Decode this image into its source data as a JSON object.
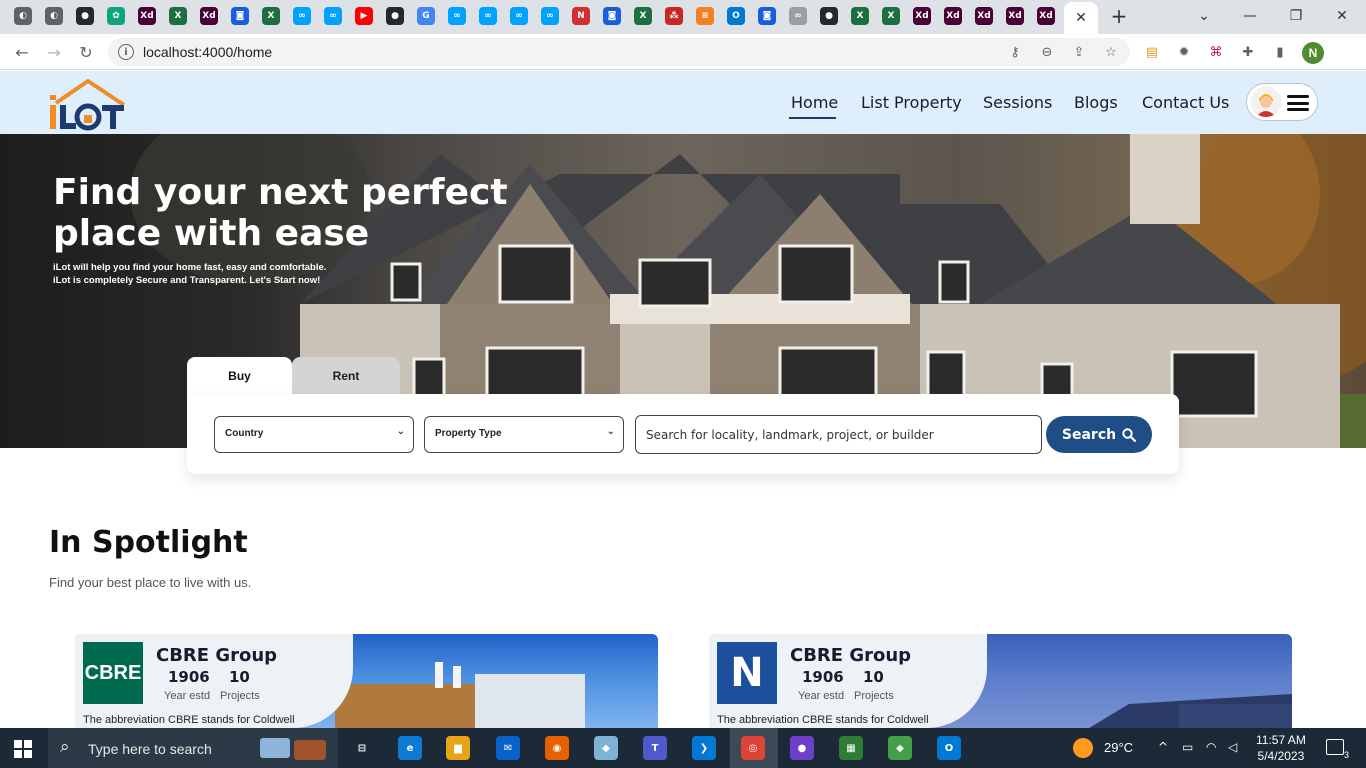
{
  "browser": {
    "tab_favicons": [
      {
        "icon": "chrome-icon",
        "glyph": "◐",
        "color": "#5f6368"
      },
      {
        "icon": "chrome-icon",
        "glyph": "◐",
        "color": "#5f6368"
      },
      {
        "icon": "github-icon",
        "glyph": "●",
        "color": "#24292f"
      },
      {
        "icon": "chatgpt-icon",
        "glyph": "✿",
        "color": "#10a37f"
      },
      {
        "icon": "adobe-xd-icon",
        "glyph": "Xd",
        "color": "#470137"
      },
      {
        "icon": "excel-icon",
        "glyph": "X",
        "color": "#1d6f42"
      },
      {
        "icon": "adobe-xd-icon",
        "glyph": "Xd",
        "color": "#470137"
      },
      {
        "icon": "bitwarden-icon",
        "glyph": "◙",
        "color": "#175ddc"
      },
      {
        "icon": "excel-icon",
        "glyph": "X",
        "color": "#1d6f42"
      },
      {
        "icon": "meta-icon",
        "glyph": "∞",
        "color": "#00a2ff"
      },
      {
        "icon": "meta-icon",
        "glyph": "∞",
        "color": "#00a2ff"
      },
      {
        "icon": "youtube-icon",
        "glyph": "▶",
        "color": "#ff0000"
      },
      {
        "icon": "github-icon",
        "glyph": "●",
        "color": "#24292f"
      },
      {
        "icon": "google-icon",
        "glyph": "G",
        "color": "#4285f4"
      },
      {
        "icon": "meta-icon",
        "glyph": "∞",
        "color": "#00a2ff"
      },
      {
        "icon": "meta-icon",
        "glyph": "∞",
        "color": "#00a2ff"
      },
      {
        "icon": "meta-icon",
        "glyph": "∞",
        "color": "#00a2ff"
      },
      {
        "icon": "meta-icon",
        "glyph": "∞",
        "color": "#00a2ff"
      },
      {
        "icon": "notion-icon",
        "glyph": "N",
        "color": "#d32f2f"
      },
      {
        "icon": "bitwarden-icon",
        "glyph": "◙",
        "color": "#175ddc"
      },
      {
        "icon": "excel-icon",
        "glyph": "X",
        "color": "#1d6f42"
      },
      {
        "icon": "network-icon",
        "glyph": "⁂",
        "color": "#c62828"
      },
      {
        "icon": "stackoverflow-icon",
        "glyph": "≡",
        "color": "#f48024"
      },
      {
        "icon": "outlook-icon",
        "glyph": "O",
        "color": "#0078d4"
      },
      {
        "icon": "bitwarden-icon",
        "glyph": "◙",
        "color": "#175ddc"
      },
      {
        "icon": "link-icon",
        "glyph": "∞",
        "color": "#9e9e9e"
      },
      {
        "icon": "github-icon",
        "glyph": "●",
        "color": "#24292f"
      },
      {
        "icon": "excel-icon",
        "glyph": "X",
        "color": "#1d6f42"
      },
      {
        "icon": "excel-icon",
        "glyph": "X",
        "color": "#1d6f42"
      },
      {
        "icon": "adobe-xd-icon",
        "glyph": "Xd",
        "color": "#470137"
      },
      {
        "icon": "adobe-xd-icon",
        "glyph": "Xd",
        "color": "#470137"
      },
      {
        "icon": "adobe-xd-icon",
        "glyph": "Xd",
        "color": "#470137"
      },
      {
        "icon": "adobe-xd-icon",
        "glyph": "Xd",
        "color": "#470137"
      },
      {
        "icon": "adobe-xd-icon",
        "glyph": "Xd",
        "color": "#470137"
      }
    ],
    "active_tab_close": "✕",
    "new_tab": "+",
    "window_controls": {
      "dropdown": "⌄",
      "minimize": "—",
      "restore": "❐",
      "close": "✕"
    },
    "nav": {
      "back": "←",
      "forward": "→",
      "reload": "↻"
    },
    "url": "localhost:4000/home",
    "info_glyph": "i",
    "omnibox_icons": {
      "key": "⚷",
      "zoom": "⊖",
      "share": "⇪",
      "star": "☆"
    },
    "ext_icons": {
      "clipboard": "▤",
      "bug": "✹",
      "code": "⌘",
      "puzzle": "✚",
      "sidepanel": "▮"
    },
    "profile_initial": "N"
  },
  "site": {
    "nav_links": [
      "Home",
      "List Property",
      "Sessions",
      "Blogs",
      "Contact Us"
    ],
    "hero": {
      "title": "Find your next perfect place with ease",
      "subtitle_line1": "iLot will help you find your home fast, easy and comfortable.",
      "subtitle_line2": "iLot is completely Secure and Transparent. Let's Start now!"
    },
    "search": {
      "tab_buy": "Buy",
      "tab_rent": "Rent",
      "country_label": "Country",
      "property_type_label": "Property Type",
      "query_placeholder": "Search for locality, landmark, project, or builder",
      "button_label": "Search"
    },
    "spotlight": {
      "title": "In Spotlight",
      "subtitle": "Find your best place to live with us.",
      "cards": [
        {
          "logo_text": "CBRE",
          "logo_color": "#006a4e",
          "name": "CBRE Group",
          "year": "1906",
          "year_label": "Year estd",
          "projects": "10",
          "projects_label": "Projects",
          "description": "The abbreviation CBRE stands for Coldwell"
        },
        {
          "logo_text": "N",
          "logo_color": "#1c4f9c",
          "name": "CBRE Group",
          "year": "1906",
          "year_label": "Year estd",
          "projects": "10",
          "projects_label": "Projects",
          "description": "The abbreviation CBRE stands for Coldwell"
        }
      ]
    }
  },
  "taskbar": {
    "search_placeholder": "Type here to search",
    "weather_temp": "29°C",
    "clock_time": "11:57 AM",
    "clock_date": "5/4/2023",
    "notification_count": "3",
    "apps": [
      {
        "icon": "task-view-icon",
        "glyph": "⊟",
        "color": "#1c2a38"
      },
      {
        "icon": "edge-icon",
        "glyph": "e",
        "color": "#0c7bd6"
      },
      {
        "icon": "file-explorer-icon",
        "glyph": "▆",
        "color": "#e8a317"
      },
      {
        "icon": "mail-icon",
        "glyph": "✉",
        "color": "#0a64c8"
      },
      {
        "icon": "firefox-icon",
        "glyph": "◉",
        "color": "#e66000"
      },
      {
        "icon": "notes-icon",
        "glyph": "◆",
        "color": "#7fb3d5"
      },
      {
        "icon": "teams-icon",
        "glyph": "T",
        "color": "#5059c9"
      },
      {
        "icon": "vscode-icon",
        "glyph": "❯",
        "color": "#0078d4"
      },
      {
        "icon": "chrome-icon",
        "glyph": "◎",
        "color": "#db4437"
      },
      {
        "icon": "github-desktop-icon",
        "glyph": "●",
        "color": "#6e40c9"
      },
      {
        "icon": "sheets-icon",
        "glyph": "▦",
        "color": "#2e7d32"
      },
      {
        "icon": "git-icon",
        "glyph": "◆",
        "color": "#43a047"
      },
      {
        "icon": "outlook-icon",
        "glyph": "O",
        "color": "#0078d4"
      }
    ],
    "system_icons": {
      "chevron": "^",
      "battery": "▭",
      "wifi": "◠",
      "volume": "◁"
    }
  }
}
